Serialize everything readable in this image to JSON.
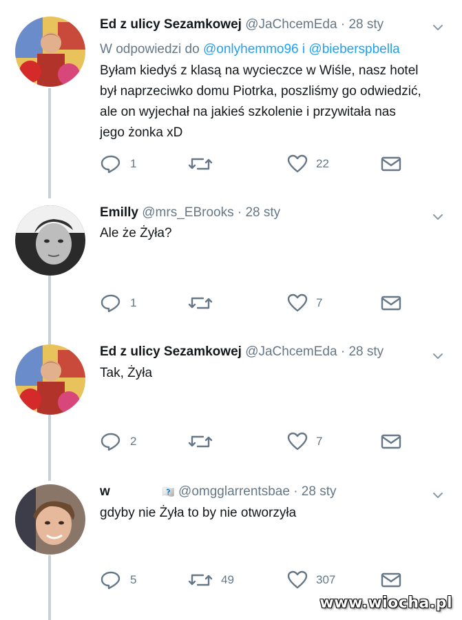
{
  "tweets": [
    {
      "name": "Ed z ulicy Sezamkowej",
      "handle": "@JaChcemEda",
      "dot": "·",
      "time": "28 sty",
      "reply_prefix": "W odpowiedzi do",
      "reply_user1": "@onlyhemmo96",
      "reply_and": "i",
      "reply_user2": "@bieberspbella",
      "text": "Byłam kiedyś z klasą na wycieczce w Wiśle, nasz hotel był naprzeciwko domu Piotrka, poszliśmy go odwiedzić, ale on wyjechał na jakieś szkolenie i przywitała nas jego żonka xD",
      "replies": "1",
      "retweets": "",
      "likes": "22"
    },
    {
      "name": "Emilly",
      "handle": "@mrs_EBrooks",
      "dot": "·",
      "time": "28 sty",
      "text": "Ale że Żyła?",
      "replies": "1",
      "retweets": "",
      "likes": "7"
    },
    {
      "name": "Ed z ulicy Sezamkowej",
      "handle": "@JaChcemEda",
      "dot": "·",
      "time": "28 sty",
      "text": "Tak, Żyła",
      "replies": "2",
      "retweets": "",
      "likes": "7"
    },
    {
      "name": "w",
      "name_emoji": "🇽🇽",
      "handle": "@omgglarrentsbae",
      "dot": "·",
      "time": "28 sty",
      "text": "gdyby nie Żyła to by nie otworzyła",
      "replies": "5",
      "retweets": "49",
      "likes": "307"
    }
  ],
  "icons": {
    "reply": "reply-icon",
    "retweet": "retweet-icon",
    "like": "heart-icon",
    "dm": "envelope-icon",
    "caret": "chevron-down-icon"
  },
  "colors": {
    "name": "#14171a",
    "meta": "#657786",
    "link": "#1da1f2",
    "thread_line": "#c8d0d8"
  },
  "watermark": "www.wiocha.pl"
}
